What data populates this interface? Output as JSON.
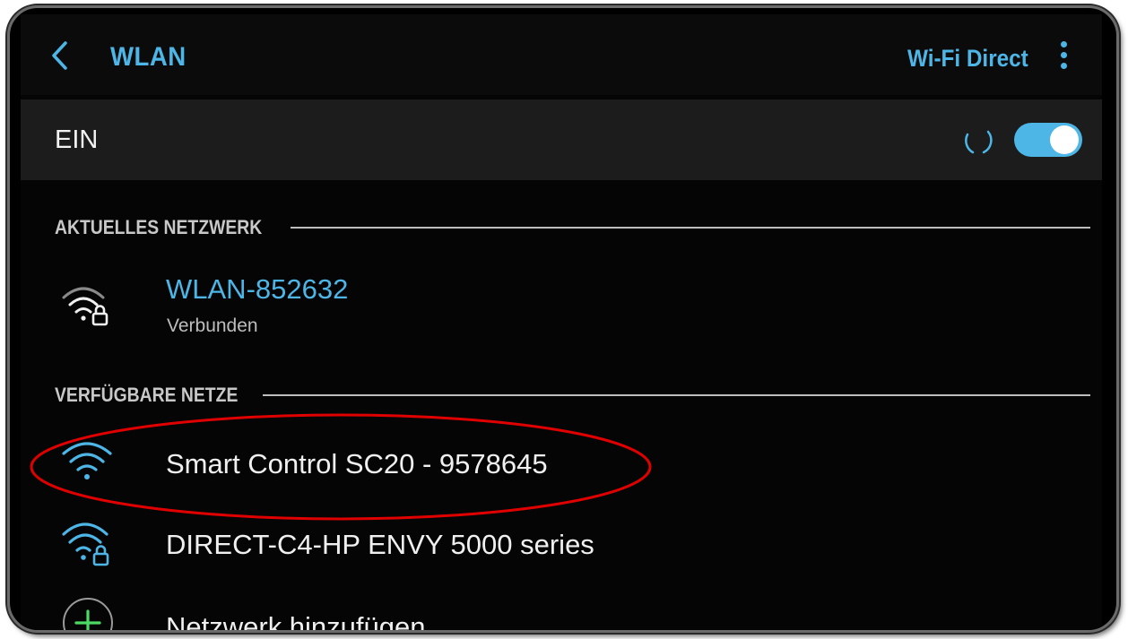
{
  "header": {
    "title": "WLAN",
    "wifi_direct_label": "Wi-Fi Direct"
  },
  "switch": {
    "label": "EIN",
    "enabled": true
  },
  "current_network": {
    "section_label": "AKTUELLES NETZWERK",
    "name": "WLAN-852632",
    "status": "Verbunden",
    "icon": "wifi-locked-icon"
  },
  "available_networks": {
    "section_label": "VERFÜGBARE NETZE",
    "items": [
      {
        "name": "Smart Control SC20 - 9578645",
        "icon": "wifi-icon",
        "secured": false,
        "highlighted": true
      },
      {
        "name": "DIRECT-C4-HP ENVY 5000 series",
        "icon": "wifi-locked-icon",
        "secured": true,
        "highlighted": false
      }
    ],
    "add_label": "Netzwerk hinzufügen"
  },
  "colors": {
    "accent": "#4db6e6",
    "highlight": "#e00000",
    "add_icon": "#4cd964"
  }
}
